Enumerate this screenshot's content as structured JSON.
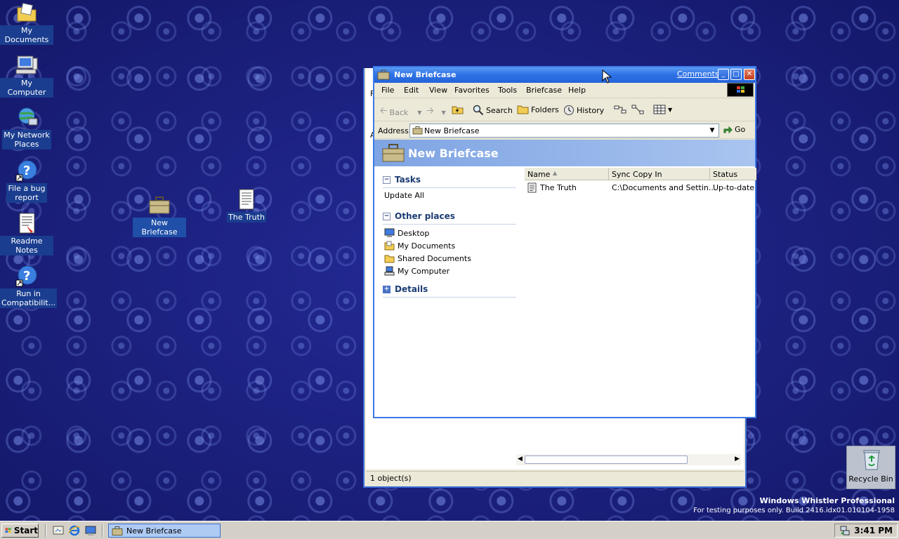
{
  "desktop": {
    "icons": [
      {
        "label": "My Documents"
      },
      {
        "label": "My Computer"
      },
      {
        "label_line1": "My Network",
        "label_line2": "Places"
      },
      {
        "label_line1": "File a bug",
        "label_line2": "report"
      },
      {
        "label": "Readme Notes"
      },
      {
        "label_line1": "Run in",
        "label_line2": "Compatibilit..."
      },
      {
        "label": "New Briefcase"
      },
      {
        "label": "The Truth"
      }
    ],
    "recycle_bin": "Recycle Bin",
    "watermark": {
      "line1": "Windows Whistler Professional",
      "line2": "For testing purposes only. Build 2416.idx01.010104-1958"
    }
  },
  "window": {
    "title": "New Briefcase",
    "comments_link": "Comments?",
    "menu": [
      "File",
      "Edit",
      "View",
      "Favorites",
      "Tools",
      "Briefcase",
      "Help"
    ],
    "toolbar": {
      "back": "Back",
      "search": "Search",
      "folders": "Folders",
      "history": "History"
    },
    "address": {
      "label": "Address",
      "value": "New Briefcase",
      "go": "Go"
    },
    "banner_title": "New Briefcase",
    "tasks": {
      "heading": "Tasks",
      "items": [
        "Update All"
      ]
    },
    "other_places": {
      "heading": "Other places",
      "items": [
        "Desktop",
        "My Documents",
        "Shared Documents",
        "My Computer"
      ]
    },
    "details": {
      "heading": "Details"
    },
    "columns": [
      "Name",
      "Sync Copy In",
      "Status"
    ],
    "rows": [
      {
        "name": "The Truth",
        "sync_copy_in": "C:\\Documents and Settin...",
        "status": "Up-to-date"
      }
    ]
  },
  "back_window": {
    "edge_f": "F",
    "edge_a": "A",
    "status": "1 object(s)"
  },
  "taskbar": {
    "start": "Start",
    "task_button": "New Briefcase",
    "clock": "3:41 PM"
  }
}
